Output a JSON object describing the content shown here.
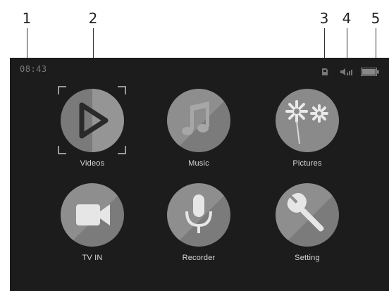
{
  "callouts": [
    "1",
    "2",
    "3",
    "4",
    "5"
  ],
  "status_bar": {
    "time": "08:43",
    "icons": [
      "sd-card-icon",
      "volume-icon",
      "battery-icon"
    ]
  },
  "apps": [
    {
      "label": "Videos",
      "icon": "play-icon",
      "color": "#8c8c8c",
      "selected": true
    },
    {
      "label": "Music",
      "icon": "music-note-icon",
      "color": "#8c8c8c"
    },
    {
      "label": "Pictures",
      "icon": "flower-icon",
      "color": "#8c8c8c"
    },
    {
      "label": "TV IN",
      "icon": "video-camera-icon",
      "color": "#8c8c8c"
    },
    {
      "label": "Recorder",
      "icon": "microphone-icon",
      "color": "#8c8c8c"
    },
    {
      "label": "Setting",
      "icon": "wrench-icon",
      "color": "#8c8c8c"
    }
  ]
}
